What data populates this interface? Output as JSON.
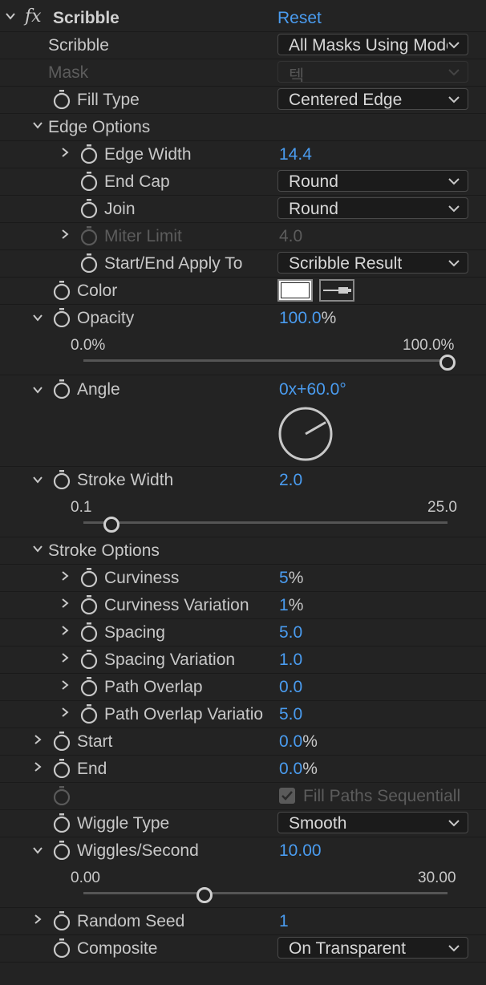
{
  "effect": {
    "name": "Scribble",
    "fx_label": "fx",
    "reset_label": "Reset"
  },
  "props": {
    "scribble": {
      "label": "Scribble",
      "value": "All Masks Using Modes"
    },
    "mask": {
      "label": "Mask",
      "value": "텍"
    },
    "fill_type": {
      "label": "Fill Type",
      "value": "Centered Edge"
    },
    "edge_options": {
      "label": "Edge Options"
    },
    "edge_width": {
      "label": "Edge Width",
      "value": "14.4"
    },
    "end_cap": {
      "label": "End Cap",
      "value": "Round"
    },
    "join": {
      "label": "Join",
      "value": "Round"
    },
    "miter_limit": {
      "label": "Miter Limit",
      "value": "4.0"
    },
    "start_end_apply": {
      "label": "Start/End Apply To",
      "value": "Scribble Result"
    },
    "color": {
      "label": "Color",
      "swatch": "#ffffff"
    },
    "opacity": {
      "label": "Opacity",
      "value": "100.0",
      "unit": "%",
      "min_label": "0.0%",
      "max_label": "100.0%",
      "fraction": 1.0
    },
    "angle": {
      "label": "Angle",
      "value": "0x+60.0°",
      "degrees": 60
    },
    "stroke_width": {
      "label": "Stroke Width",
      "value": "2.0",
      "min_label": "0.1",
      "max_label": "25.0",
      "value_num": 2.0,
      "min": 0.1,
      "max": 25.0
    },
    "stroke_options": {
      "label": "Stroke Options"
    },
    "curviness": {
      "label": "Curviness",
      "value": "5",
      "unit": "%"
    },
    "curviness_variation": {
      "label": "Curviness Variation",
      "value": "1",
      "unit": "%"
    },
    "spacing": {
      "label": "Spacing",
      "value": "5.0"
    },
    "spacing_variation": {
      "label": "Spacing Variation",
      "value": "1.0"
    },
    "path_overlap": {
      "label": "Path Overlap",
      "value": "0.0"
    },
    "path_overlap_variation": {
      "label": "Path Overlap Variatio",
      "value": "5.0"
    },
    "start": {
      "label": "Start",
      "value": "0.0",
      "unit": "%"
    },
    "end": {
      "label": "End",
      "value": "0.0",
      "unit": "%"
    },
    "fill_paths": {
      "label": "Fill Paths Sequentiall",
      "checked": true
    },
    "wiggle_type": {
      "label": "Wiggle Type",
      "value": "Smooth"
    },
    "wiggles_per_second": {
      "label": "Wiggles/Second",
      "value": "10.00",
      "min_label": "0.00",
      "max_label": "30.00",
      "value_num": 10.0,
      "min": 0,
      "max": 30
    },
    "random_seed": {
      "label": "Random Seed",
      "value": "1"
    },
    "composite": {
      "label": "Composite",
      "value": "On Transparent"
    }
  },
  "colors": {
    "accent_blue": "#4a9cf0",
    "panel_bg": "#232323",
    "text": "#c8c8c8"
  }
}
